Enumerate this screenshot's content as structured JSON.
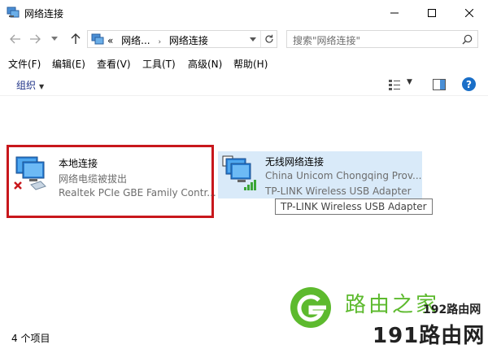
{
  "window": {
    "title": "网络连接",
    "minimize_glyph": "—",
    "maximize_glyph": "☐",
    "close_glyph": "✕"
  },
  "address": {
    "overflow": "«",
    "crumbs": [
      "网络...",
      "网络连接"
    ],
    "separator": "›"
  },
  "search": {
    "placeholder": "搜索\"网络连接\""
  },
  "menu": {
    "items": [
      "文件(F)",
      "编辑(E)",
      "查看(V)",
      "工具(T)",
      "高级(N)",
      "帮助(H)"
    ]
  },
  "commandbar": {
    "organize_label": "组织",
    "help_label": "?"
  },
  "connections": [
    {
      "name": "本地连接",
      "status": "网络电缆被拔出",
      "device": "Realtek PCIe GBE Family Contr...",
      "icon": "ethernet-disconnected-icon"
    },
    {
      "name": "无线网络连接",
      "status": "China Unicom Chongqing Prov...",
      "device": "TP-LINK Wireless USB Adapter",
      "icon": "wireless-signal-icon"
    }
  ],
  "tooltip": {
    "text": "TP-LINK Wireless USB Adapter"
  },
  "watermark": {
    "brand": "路由之家",
    "site_top": "192路由网",
    "site_bottom": "191路由网"
  },
  "statusbar": {
    "count_text": "4 个项目"
  },
  "colors": {
    "highlight_border": "#c8171c",
    "selected_tile": "#d9eaf9",
    "accent": "#1a6fc8"
  }
}
